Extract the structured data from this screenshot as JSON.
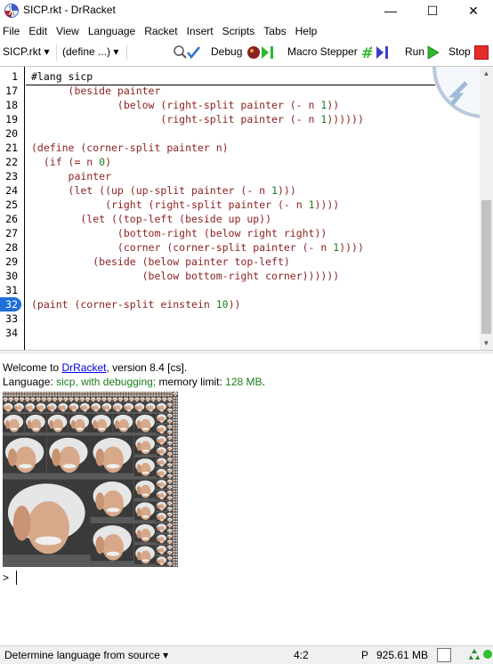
{
  "window": {
    "title": "SICP.rkt - DrRacket",
    "minimize_glyph": "—",
    "maximize_glyph": "☐",
    "close_glyph": "✕"
  },
  "menu": [
    "File",
    "Edit",
    "View",
    "Language",
    "Racket",
    "Insert",
    "Scripts",
    "Tabs",
    "Help"
  ],
  "toolbar": {
    "file_dropdown": "SICP.rkt ▾",
    "define_dropdown": "(define ...) ▾",
    "debug_label": "Debug",
    "macro_label": "Macro Stepper",
    "run_label": "Run",
    "stop_label": "Stop",
    "run_color": "#2db82d",
    "stop_color": "#e32d2d"
  },
  "editor": {
    "header_line_number": "1",
    "header_text": "#lang sicp",
    "lines": [
      {
        "n": "17",
        "text": "      (beside painter"
      },
      {
        "n": "18",
        "text": "              (below (right-split painter (- n 1))"
      },
      {
        "n": "19",
        "text": "                     (right-split painter (- n 1))))))"
      },
      {
        "n": "20",
        "text": ""
      },
      {
        "n": "21",
        "text": "(define (corner-split painter n)"
      },
      {
        "n": "22",
        "text": "  (if (= n 0)"
      },
      {
        "n": "23",
        "text": "      painter"
      },
      {
        "n": "24",
        "text": "      (let ((up (up-split painter (- n 1)))"
      },
      {
        "n": "25",
        "text": "            (right (right-split painter (- n 1))))"
      },
      {
        "n": "26",
        "text": "        (let ((top-left (beside up up))"
      },
      {
        "n": "27",
        "text": "              (bottom-right (below right right))"
      },
      {
        "n": "28",
        "text": "              (corner (corner-split painter (- n 1))))"
      },
      {
        "n": "29",
        "text": "          (beside (below painter top-left)"
      },
      {
        "n": "30",
        "text": "                  (below bottom-right corner))))))"
      },
      {
        "n": "31",
        "text": ""
      },
      {
        "n": "32",
        "text": "(paint (corner-split einstein 10))"
      },
      {
        "n": "33",
        "text": ""
      },
      {
        "n": "34",
        "text": ""
      }
    ],
    "active_line": "32"
  },
  "interactions": {
    "welcome_prefix": "Welcome to ",
    "welcome_link": "DrRacket",
    "welcome_suffix": ", version 8.4 [cs].",
    "language_prefix": "Language: ",
    "language_value": "sicp, with debugging;",
    "memory_prefix": " memory limit: ",
    "memory_value": "128 MB",
    "memory_suffix": ".",
    "prompt": ">"
  },
  "status": {
    "language_selector": "Determine language from source ▾",
    "position": "4:2",
    "p_label": "P",
    "memory": "925.61 MB"
  },
  "icons": {
    "app": "drracket-lambda-icon",
    "check_syntax": "check-syntax-icon",
    "debug": "debug-icon",
    "macro": "macro-stepper-icon",
    "run": "run-arrow-icon",
    "stop": "stop-square-icon",
    "recycle": "gc-recycle-icon"
  }
}
